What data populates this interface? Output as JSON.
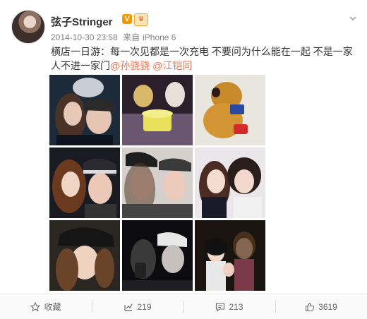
{
  "user": {
    "name": "弦子Stringer",
    "verified_label": "V",
    "member_badge_icon": "crown-icon"
  },
  "meta": {
    "timestamp": "2014-10-30 23:58",
    "source_prefix": "来自",
    "source_device": "iPhone 6"
  },
  "post": {
    "text": "横店一日游：每一次见都是一次充电 不要问为什么能在一起 不是一家人不进一家门",
    "mentions": [
      "@孙骁骁",
      "@江铠同"
    ]
  },
  "photos": [
    {
      "name": "photo-1",
      "desc_icon": "selfie-two-girls-icon"
    },
    {
      "name": "photo-2",
      "desc_icon": "plush-toys-icon"
    },
    {
      "name": "photo-3",
      "desc_icon": "plush-dog-phone-icon"
    },
    {
      "name": "photo-4",
      "desc_icon": "selfie-hat-icon"
    },
    {
      "name": "photo-5",
      "desc_icon": "selfie-caps-icon"
    },
    {
      "name": "photo-6",
      "desc_icon": "selfie-two-girls-icon"
    },
    {
      "name": "photo-7",
      "desc_icon": "selfie-cap-icon"
    },
    {
      "name": "photo-8",
      "desc_icon": "night-selfie-icon"
    },
    {
      "name": "photo-9",
      "desc_icon": "group-photo-icon"
    }
  ],
  "actions": {
    "favorite_label": "收藏",
    "repost_count": "219",
    "comment_count": "213",
    "like_count": "3619"
  },
  "colors": {
    "accent": "#eb7350",
    "verified": "#f39800"
  }
}
